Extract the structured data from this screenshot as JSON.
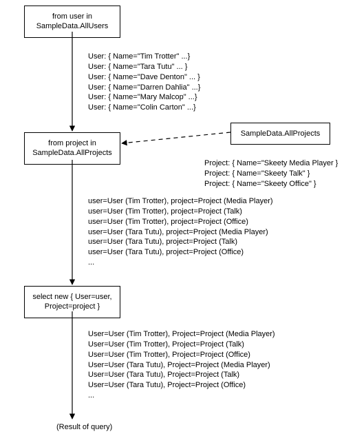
{
  "boxes": {
    "source_users": "from user in\nSampleData.AllUsers",
    "source_projects_join": "from project in\nSampleData.AllProjects",
    "source_projects_box": "SampleData.AllProjects",
    "select": "select new { User=user,\nProject=project }"
  },
  "lists": {
    "users": [
      "User: { Name=\"Tim Trotter\" ...}",
      "User: { Name=\"Tara Tutu\" ... }",
      "User: { Name=\"Dave Denton\" ... }",
      "User: { Name=\"Darren Dahlia\" ...}",
      "User: { Name=\"Mary Malcop\" ...}",
      "User: { Name=\"Colin Carton\" ...}"
    ],
    "projects": [
      "Project: { Name=\"Skeety Media Player }",
      "Project: { Name=\"Skeety Talk\" }",
      "Project: { Name=\"Skeety Office\" }"
    ],
    "joined_pairs": [
      "user=User (Tim Trotter), project=Project (Media Player)",
      "user=User (Tim Trotter), project=Project (Talk)",
      "user=User (Tim Trotter), project=Project (Office)",
      "user=User (Tara Tutu), project=Project (Media Player)",
      "user=User (Tara Tutu), project=Project (Talk)",
      "user=User (Tara Tutu), project=Project (Office)",
      "..."
    ],
    "selected": [
      "User=User (Tim Trotter), Project=Project (Media Player)",
      "User=User (Tim Trotter), Project=Project (Talk)",
      "User=User (Tim Trotter), Project=Project (Office)",
      "User=User (Tara Tutu), Project=Project (Media Player)",
      "User=User (Tara Tutu), Project=Project (Talk)",
      "User=User (Tara Tutu), Project=Project (Office)",
      "..."
    ]
  },
  "result_label": "(Result of query)"
}
